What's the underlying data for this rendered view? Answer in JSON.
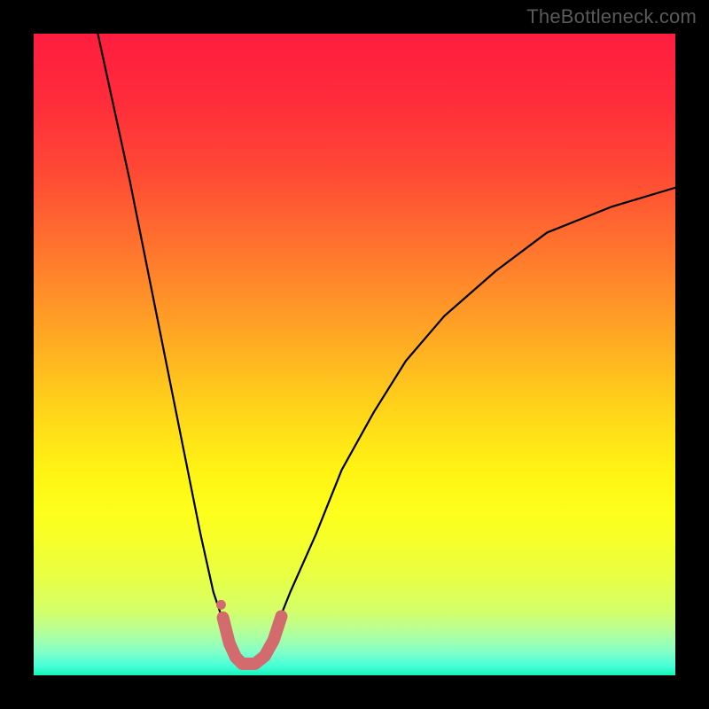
{
  "watermark": "TheBottleneck.com",
  "chart_data": {
    "type": "line",
    "title": "",
    "xlabel": "",
    "ylabel": "",
    "xlim": [
      0,
      100
    ],
    "ylim": [
      0,
      100
    ],
    "grid": false,
    "series": [
      {
        "name": "curve",
        "color": "#000000",
        "x": [
          10,
          15,
          20,
          23,
          26,
          28,
          30,
          31,
          32,
          33,
          34,
          35,
          36,
          38,
          40,
          44,
          48,
          53,
          58,
          64,
          72,
          80,
          90,
          100
        ],
        "y": [
          100,
          77,
          52,
          37,
          22,
          13,
          7,
          4,
          2,
          1,
          1,
          2,
          4,
          8,
          13,
          22,
          32,
          41,
          49,
          56,
          63,
          69,
          73,
          76
        ]
      },
      {
        "name": "worm",
        "color": "#d36b6e",
        "x": [
          29.5,
          30.5,
          31.5,
          32.5,
          34.5,
          36.0,
          37.4,
          38.6
        ],
        "y": [
          9.0,
          5.0,
          2.8,
          1.8,
          1.8,
          3.0,
          5.5,
          9.2
        ]
      }
    ],
    "annotations": [
      {
        "type": "dot",
        "series": "worm",
        "x": 29.2,
        "y": 11.0,
        "color": "#d36b6e"
      }
    ]
  }
}
